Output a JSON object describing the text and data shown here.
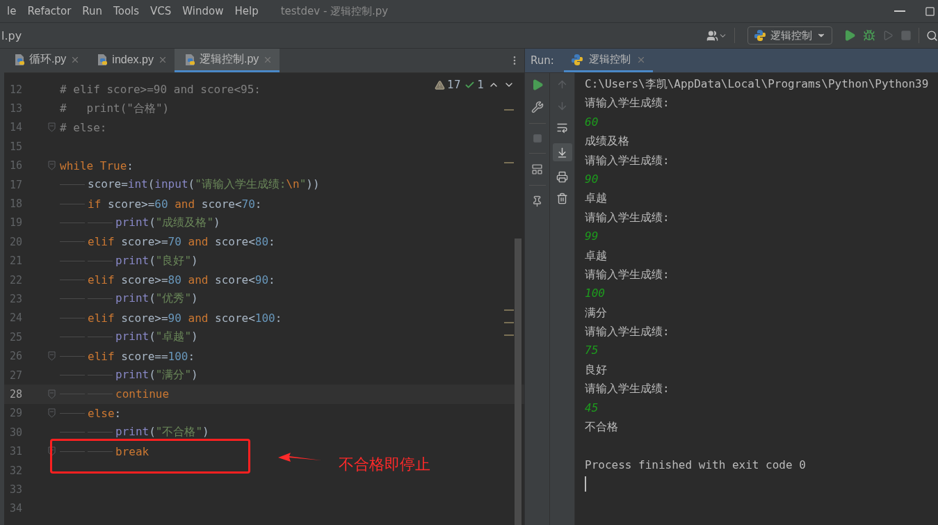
{
  "menu": [
    "le",
    "Refactor",
    "Run",
    "Tools",
    "VCS",
    "Window",
    "Help"
  ],
  "window": {
    "title": "testdev - 逻辑控制.py"
  },
  "breadcrumb": "l.py",
  "run_config": "逻辑控制",
  "tabs": [
    {
      "label": "循环.py",
      "selected": false
    },
    {
      "label": "index.py",
      "selected": false
    },
    {
      "label": "逻辑控制.py",
      "selected": true
    }
  ],
  "inspections": {
    "warnings": "17",
    "weak_warnings": "1"
  },
  "code_lines": [
    {
      "n": "12",
      "fold": false,
      "current": false,
      "tokens": [
        {
          "kind": "comment",
          "text": "# elif score>=90 and score<95:"
        }
      ]
    },
    {
      "n": "13",
      "fold": false,
      "current": false,
      "tokens": [
        {
          "kind": "comment",
          "text": "#   print(\"合格\")"
        }
      ]
    },
    {
      "n": "14",
      "fold": true,
      "current": false,
      "tokens": [
        {
          "kind": "comment",
          "text": "# else:"
        }
      ]
    },
    {
      "n": "15",
      "fold": false,
      "current": false
    },
    {
      "n": "16",
      "fold": true,
      "current": false,
      "tokens": [
        {
          "kind": "kw",
          "text": "while True"
        },
        {
          "kind": "plain",
          "text": ":"
        }
      ],
      "children": [
        {
          "n": "17",
          "fold": false,
          "current": false,
          "tokens": [
            {
              "kind": "plain",
              "text": "score="
            },
            {
              "kind": "fn",
              "text": "int"
            },
            {
              "kind": "plain",
              "text": "("
            },
            {
              "kind": "fn",
              "text": "input"
            },
            {
              "kind": "plain",
              "text": "("
            },
            {
              "kind": "str",
              "text": "\"请输入学生成绩:"
            },
            {
              "kind": "kw",
              "text": "\\n"
            },
            {
              "kind": "str",
              "text": "\""
            },
            {
              "kind": "plain",
              "text": "))"
            }
          ]
        },
        {
          "n": "18",
          "fold": false,
          "current": false,
          "tokens": [
            {
              "kind": "kw",
              "text": "if"
            },
            {
              "kind": "plain",
              "text": " score>="
            },
            {
              "kind": "num",
              "text": "60"
            },
            {
              "kind": "kw",
              "text": " and"
            },
            {
              "kind": "plain",
              "text": " score<"
            },
            {
              "kind": "num",
              "text": "70"
            },
            {
              "kind": "plain",
              "text": ":"
            }
          ],
          "children": [
            {
              "n": "19",
              "fold": false,
              "current": false,
              "tokens": [
                {
                  "kind": "fn",
                  "text": "print"
                },
                {
                  "kind": "plain",
                  "text": "("
                },
                {
                  "kind": "str",
                  "text": "\"成绩及格\""
                },
                {
                  "kind": "plain",
                  "text": ")"
                }
              ]
            }
          ]
        },
        {
          "n": "20",
          "fold": false,
          "current": false,
          "tokens": [
            {
              "kind": "kw",
              "text": "elif"
            },
            {
              "kind": "plain",
              "text": " score>="
            },
            {
              "kind": "num",
              "text": "70"
            },
            {
              "kind": "kw",
              "text": " and"
            },
            {
              "kind": "plain",
              "text": " score<"
            },
            {
              "kind": "num",
              "text": "80"
            },
            {
              "kind": "plain",
              "text": ":"
            }
          ],
          "children": [
            {
              "n": "21",
              "fold": false,
              "current": false,
              "tokens": [
                {
                  "kind": "fn",
                  "text": "print"
                },
                {
                  "kind": "plain",
                  "text": "("
                },
                {
                  "kind": "str",
                  "text": "\"良好\""
                },
                {
                  "kind": "plain",
                  "text": ")"
                }
              ]
            }
          ]
        },
        {
          "n": "22",
          "fold": false,
          "current": false,
          "tokens": [
            {
              "kind": "kw",
              "text": "elif"
            },
            {
              "kind": "plain",
              "text": " score>="
            },
            {
              "kind": "num",
              "text": "80"
            },
            {
              "kind": "kw",
              "text": " and"
            },
            {
              "kind": "plain",
              "text": " score<"
            },
            {
              "kind": "num",
              "text": "90"
            },
            {
              "kind": "plain",
              "text": ":"
            }
          ],
          "children": [
            {
              "n": "23",
              "fold": false,
              "current": false,
              "tokens": [
                {
                  "kind": "fn",
                  "text": "print"
                },
                {
                  "kind": "plain",
                  "text": "("
                },
                {
                  "kind": "str",
                  "text": "\"优秀\""
                },
                {
                  "kind": "plain",
                  "text": ")"
                }
              ]
            }
          ]
        },
        {
          "n": "24",
          "fold": false,
          "current": false,
          "tokens": [
            {
              "kind": "kw",
              "text": "elif"
            },
            {
              "kind": "plain",
              "text": " score>="
            },
            {
              "kind": "num",
              "text": "90"
            },
            {
              "kind": "kw",
              "text": " and"
            },
            {
              "kind": "plain",
              "text": " score<"
            },
            {
              "kind": "num",
              "text": "100"
            },
            {
              "kind": "plain",
              "text": ":"
            }
          ],
          "children": [
            {
              "n": "25",
              "fold": false,
              "current": false,
              "tokens": [
                {
                  "kind": "fn",
                  "text": "print"
                },
                {
                  "kind": "plain",
                  "text": "("
                },
                {
                  "kind": "str",
                  "text": "\"卓越\""
                },
                {
                  "kind": "plain",
                  "text": ")"
                }
              ]
            }
          ]
        },
        {
          "n": "26",
          "fold": true,
          "current": false,
          "tokens": [
            {
              "kind": "kw",
              "text": "elif"
            },
            {
              "kind": "plain",
              "text": " score=="
            },
            {
              "kind": "num",
              "text": "100"
            },
            {
              "kind": "plain",
              "text": ":"
            }
          ],
          "children": [
            {
              "n": "27",
              "fold": false,
              "current": false,
              "tokens": [
                {
                  "kind": "fn",
                  "text": "print"
                },
                {
                  "kind": "plain",
                  "text": "("
                },
                {
                  "kind": "str",
                  "text": "\"满分\""
                },
                {
                  "kind": "plain",
                  "text": ")"
                }
              ]
            },
            {
              "n": "28",
              "fold": true,
              "current": true,
              "tokens": [
                {
                  "kind": "kw",
                  "text": "continue"
                }
              ]
            }
          ]
        },
        {
          "n": "29",
          "fold": true,
          "current": false,
          "tokens": [
            {
              "kind": "kw",
              "text": "else"
            },
            {
              "kind": "plain",
              "text": ":"
            }
          ],
          "children": [
            {
              "n": "30",
              "fold": false,
              "current": false,
              "tokens": [
                {
                  "kind": "fn",
                  "text": "print"
                },
                {
                  "kind": "plain",
                  "text": "("
                },
                {
                  "kind": "str",
                  "text": "\"不合格\""
                },
                {
                  "kind": "plain",
                  "text": ")"
                }
              ]
            },
            {
              "n": "31",
              "fold": true,
              "current": false,
              "tokens": [
                {
                  "kind": "kw",
                  "text": "break"
                }
              ]
            }
          ]
        }
      ]
    },
    {
      "n": "32",
      "fold": false,
      "current": false
    },
    {
      "n": "33",
      "fold": false,
      "current": false
    },
    {
      "n": "34",
      "fold": false,
      "current": false
    }
  ],
  "annotation": "不合格即停止",
  "run_panel": {
    "label": "Run:",
    "tab": "逻辑控制",
    "console": [
      {
        "kind": "out",
        "text": "C:\\Users\\李凯\\AppData\\Local\\Programs\\Python\\Python39"
      },
      {
        "kind": "out",
        "text": "请输入学生成绩:"
      },
      {
        "kind": "input",
        "text": "60"
      },
      {
        "kind": "out",
        "text": "成绩及格"
      },
      {
        "kind": "out",
        "text": "请输入学生成绩:"
      },
      {
        "kind": "input",
        "text": "90"
      },
      {
        "kind": "out",
        "text": "卓越"
      },
      {
        "kind": "out",
        "text": "请输入学生成绩:"
      },
      {
        "kind": "input",
        "text": "99"
      },
      {
        "kind": "out",
        "text": "卓越"
      },
      {
        "kind": "out",
        "text": "请输入学生成绩:"
      },
      {
        "kind": "input",
        "text": "100"
      },
      {
        "kind": "out",
        "text": "满分"
      },
      {
        "kind": "out",
        "text": "请输入学生成绩:"
      },
      {
        "kind": "input",
        "text": "75"
      },
      {
        "kind": "out",
        "text": "良好"
      },
      {
        "kind": "out",
        "text": "请输入学生成绩:"
      },
      {
        "kind": "input",
        "text": "45"
      },
      {
        "kind": "out",
        "text": "不合格"
      },
      {
        "kind": "blank"
      },
      {
        "kind": "out",
        "text": "Process finished with exit code 0"
      },
      {
        "kind": "cursor"
      }
    ]
  }
}
